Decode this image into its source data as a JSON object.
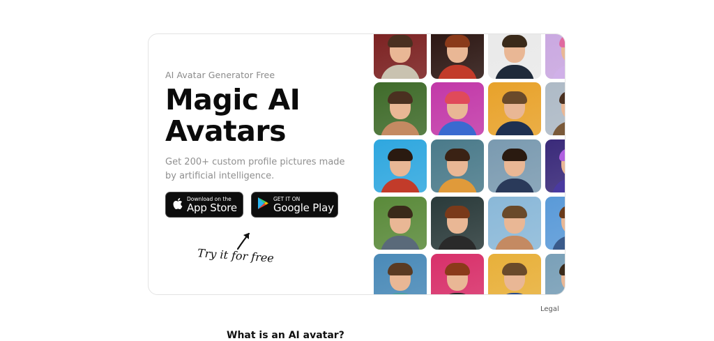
{
  "hero": {
    "eyebrow": "AI Avatar Generator Free",
    "headline": "Magic AI Avatars",
    "subtitle": "Get 200+ custom profile pictures made by artificial intelligence.",
    "app_store": {
      "small": "Download on the",
      "big": "App Store"
    },
    "google_play": {
      "small": "GET IT ON",
      "big": "Google Play"
    },
    "cta_note": "Try it for free"
  },
  "footer": {
    "legal_link": "Legal",
    "faq_title": "What is an AI avatar?"
  },
  "colors": {
    "button_bg": "#0d0d0d",
    "card_border": "#e3e3e3",
    "muted_text": "#8a8a8a"
  },
  "avatar_tiles": [
    {
      "bg": "#7a1f1f",
      "hair": "#4a3020",
      "shoulders": "#c9c2b0"
    },
    {
      "bg": "#2a1410",
      "hair": "#8a3a1a",
      "shoulders": "#c23b2a"
    },
    {
      "bg": "#e9e9e9",
      "hair": "#3a2a1a",
      "shoulders": "#1f2a3a"
    },
    {
      "bg": "#c9a7e0",
      "hair": "#e06aa0",
      "shoulders": "#d0b0e8"
    },
    {
      "bg": "#3f6b2a",
      "hair": "#4a3020",
      "shoulders": "#c48a62"
    },
    {
      "bg": "#c238a8",
      "hair": "#e04a5a",
      "shoulders": "#3a6ad0"
    },
    {
      "bg": "#e8a22a",
      "hair": "#6a4a2a",
      "shoulders": "#1f3050"
    },
    {
      "bg": "#aebac6",
      "hair": "#4a3020",
      "shoulders": "#7a5a3a"
    },
    {
      "bg": "#2fa7df",
      "hair": "#2a1a10",
      "shoulders": "#c23b2a"
    },
    {
      "bg": "#4a7a8a",
      "hair": "#3a2214",
      "shoulders": "#e09a3a"
    },
    {
      "bg": "#7a9ab0",
      "hair": "#2a1a10",
      "shoulders": "#2a3a5a"
    },
    {
      "bg": "#3a2a7a",
      "hair": "#b060e0",
      "shoulders": "#4a3aa0"
    },
    {
      "bg": "#5a8a3a",
      "hair": "#3a2a1a",
      "shoulders": "#5a6a7a"
    },
    {
      "bg": "#2a3a3a",
      "hair": "#7a3a1a",
      "shoulders": "#2a2a2a"
    },
    {
      "bg": "#8ab8d8",
      "hair": "#6a4a2a",
      "shoulders": "#c48a62"
    },
    {
      "bg": "#5a9ad8",
      "hair": "#6a3a1a",
      "shoulders": "#3a5a8a"
    },
    {
      "bg": "#4a8ab8",
      "hair": "#5a3a22",
      "shoulders": "#4aa0a0"
    },
    {
      "bg": "#d8306a",
      "hair": "#8a3a1a",
      "shoulders": "#2a2a2a"
    },
    {
      "bg": "#e8b03a",
      "hair": "#6a4a2a",
      "shoulders": "#2a4a8a"
    },
    {
      "bg": "#7aa0b8",
      "hair": "#3a2a1a",
      "shoulders": "#5a6a8a"
    }
  ]
}
